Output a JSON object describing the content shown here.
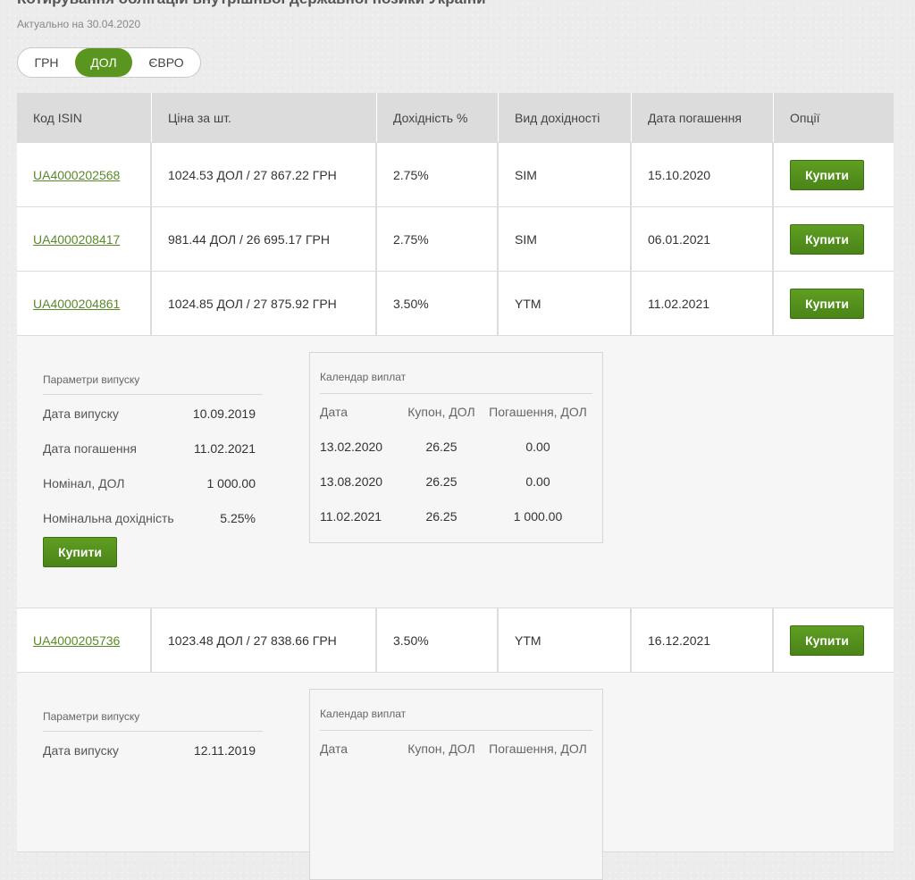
{
  "page": {
    "title": "Котирування облігацій внутрішньої державної позики України",
    "updated": "Актуально на 30.04.2020"
  },
  "currency": {
    "uah": "ГРН",
    "usd": "ДОЛ",
    "eur": "ЄВРО",
    "selected": "ДОЛ"
  },
  "table": {
    "headers": [
      "Код ISIN",
      "Ціна за шт.",
      "Дохідність %",
      "Вид дохідності",
      "Дата погашення",
      "Опції"
    ],
    "rows": [
      {
        "isin": "UA4000202568",
        "price": "1024.53 ДОЛ / 27 867.22 ГРН",
        "yield": "2.75%",
        "type": "SIM",
        "maturity": "15.10.2020",
        "buy": "Купити"
      },
      {
        "isin": "UA4000208417",
        "price": "981.44 ДОЛ / 26 695.17 ГРН",
        "yield": "2.75%",
        "type": "SIM",
        "maturity": "06.01.2021",
        "buy": "Купити"
      },
      {
        "isin": "UA4000204861",
        "price": "1024.85 ДОЛ / 27 875.92 ГРН",
        "yield": "3.50%",
        "type": "YTM",
        "maturity": "11.02.2021",
        "buy": "Купити"
      },
      {
        "isin": "UA4000205736",
        "price": "1023.48 ДОЛ / 27 838.66 ГРН",
        "yield": "3.50%",
        "type": "YTM",
        "maturity": "16.12.2021",
        "buy": "Купити"
      }
    ]
  },
  "details": [
    {
      "params_title": "Параметри випуску",
      "params": [
        {
          "label": "Дата випуску",
          "value": "10.09.2019"
        },
        {
          "label": "Дата погашення",
          "value": "11.02.2021"
        },
        {
          "label": "Номінал, ДОЛ",
          "value": "1 000.00"
        },
        {
          "label": "Номінальна дохідність",
          "value": "5.25%"
        }
      ],
      "buy": "Купити",
      "calendar_title": "Календар виплат",
      "calendar_headers": [
        "Дата",
        "Купон, ДОЛ",
        "Погашення, ДОЛ"
      ],
      "calendar_rows": [
        [
          "13.02.2020",
          "26.25",
          "0.00"
        ],
        [
          "13.08.2020",
          "26.25",
          "0.00"
        ],
        [
          "11.02.2021",
          "26.25",
          "1 000.00"
        ]
      ]
    },
    {
      "params_title": "Параметри випуску",
      "params": [
        {
          "label": "Дата випуску",
          "value": "12.11.2019"
        }
      ],
      "calendar_title": "Календар виплат",
      "calendar_headers": [
        "Дата",
        "Купон, ДОЛ",
        "Погашення, ДОЛ"
      ]
    }
  ],
  "colors": {
    "accent": "#5a961f",
    "link": "#5a8a2a",
    "header_bg": "#dcdcdc"
  }
}
